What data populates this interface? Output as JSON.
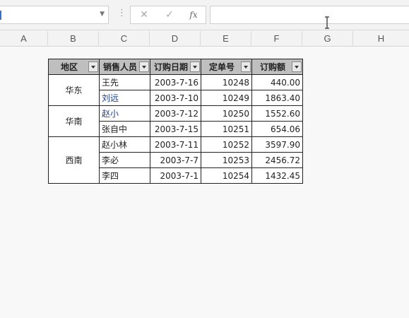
{
  "formula_bar": {
    "namebox_value": "",
    "dots": "⋮",
    "cancel_glyph": "✕",
    "enter_glyph": "✓",
    "fx_label": "fx",
    "formula_value": ""
  },
  "columns": [
    "A",
    "B",
    "C",
    "D",
    "E",
    "F",
    "G",
    "H"
  ],
  "table": {
    "headers": [
      "地区",
      "销售人员",
      "订购日期",
      "定单号",
      "订购额"
    ],
    "regions": [
      "华东",
      "华南",
      "西南"
    ],
    "rows": [
      {
        "person": "王先",
        "date": "2003-7-16",
        "order": "10248",
        "amount": "440.00"
      },
      {
        "person": "刘远",
        "date": "2003-7-10",
        "order": "10249",
        "amount": "1863.40"
      },
      {
        "person": "赵小",
        "date": "2003-7-12",
        "order": "10250",
        "amount": "1552.60"
      },
      {
        "person": "张自中",
        "date": "2003-7-15",
        "order": "10251",
        "amount": "654.06"
      },
      {
        "person": "赵小林",
        "date": "2003-7-11",
        "order": "10252",
        "amount": "3597.90"
      },
      {
        "person": "李必",
        "date": "2003-7-7",
        "order": "10253",
        "amount": "2456.72"
      },
      {
        "person": "李四",
        "date": "2003-7-1",
        "order": "10254",
        "amount": "1432.45"
      }
    ]
  },
  "colors": {
    "header_fill": "#bfbfbf",
    "blue_text": "#1f3f8f",
    "sheet_bg": "#f7f8f7"
  },
  "icons": [
    "chevron-down-icon",
    "cancel-icon",
    "enter-icon",
    "fx-icon",
    "text-cursor-icon",
    "filter-dropdown-icon"
  ]
}
